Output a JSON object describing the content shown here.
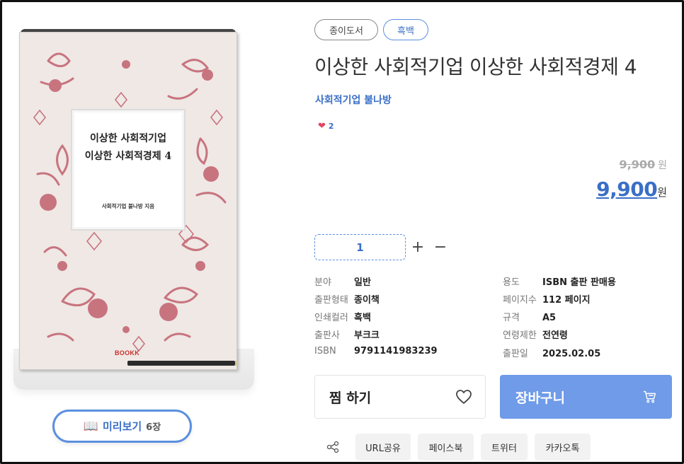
{
  "book": {
    "cover_title_line1": "이상한 사회적기업",
    "cover_title_line2": "이상한 사회적경제 4",
    "cover_author": "사회적기업 불나방 지음",
    "cover_brand": "BOOKK",
    "pattern_color": "#c8747f"
  },
  "preview": {
    "label": "미리보기",
    "count": "6장",
    "icon": "book-icon"
  },
  "tags": {
    "paper": "종이도서",
    "bw": "흑백"
  },
  "product": {
    "title": "이상한 사회적기업 이상한 사회적경제 4",
    "author": "사회적기업 불나방",
    "likes": "2"
  },
  "price": {
    "original": "9,900",
    "original_unit": "원",
    "sale": "9,900",
    "sale_unit": "원"
  },
  "quantity": {
    "value": "1",
    "plus": "+",
    "minus": "−"
  },
  "specs_left": [
    {
      "key": "분야",
      "value": "일반"
    },
    {
      "key": "출판형태",
      "value": "종이책"
    },
    {
      "key": "인쇄컬러",
      "value": "흑백"
    },
    {
      "key": "출판사",
      "value": "부크크"
    },
    {
      "key": "ISBN",
      "value": "9791141983239"
    }
  ],
  "specs_right": [
    {
      "key": "용도",
      "value": "ISBN 출판 판매용"
    },
    {
      "key": "페이지수",
      "value": "112 페이지"
    },
    {
      "key": "규격",
      "value": "A5"
    },
    {
      "key": "연령제한",
      "value": "전연령"
    },
    {
      "key": "출판일",
      "value": "2025.02.05"
    }
  ],
  "actions": {
    "wish": "찜 하기",
    "cart": "장바구니"
  },
  "share": {
    "url": "URL공유",
    "facebook": "페이스북",
    "twitter": "트위터",
    "kakao": "카카오톡"
  },
  "colors": {
    "accent": "#3a6fc7",
    "cart_bg": "#6f9be8",
    "heart": "#e0465e"
  }
}
